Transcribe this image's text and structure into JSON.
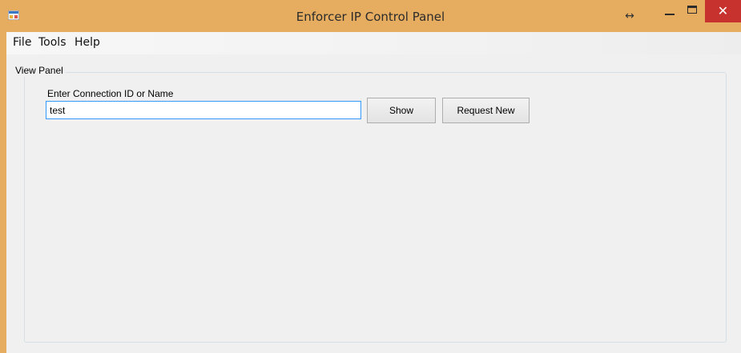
{
  "window": {
    "title": "Enforcer IP Control Panel",
    "icons": {
      "app": "app-window-icon",
      "resize": "horizontal-resize-icon",
      "minimize": "minimize-icon",
      "maximize": "maximize-icon",
      "close": "close-icon"
    },
    "resize_glyph": "↔",
    "close_glyph": "✕",
    "colors": {
      "titlebar": "#e6ad60",
      "close_button": "#c7312e",
      "client_background": "#f0f0f0",
      "input_focus_border": "#3399ff"
    }
  },
  "menubar": {
    "items": [
      {
        "label": "File"
      },
      {
        "label": "Tools"
      },
      {
        "label": "Help"
      }
    ]
  },
  "view_panel": {
    "title": "View Panel",
    "connection_label": "Enter Connection ID or Name",
    "connection_value": "test",
    "show_label": "Show",
    "request_new_label": "Request New"
  }
}
